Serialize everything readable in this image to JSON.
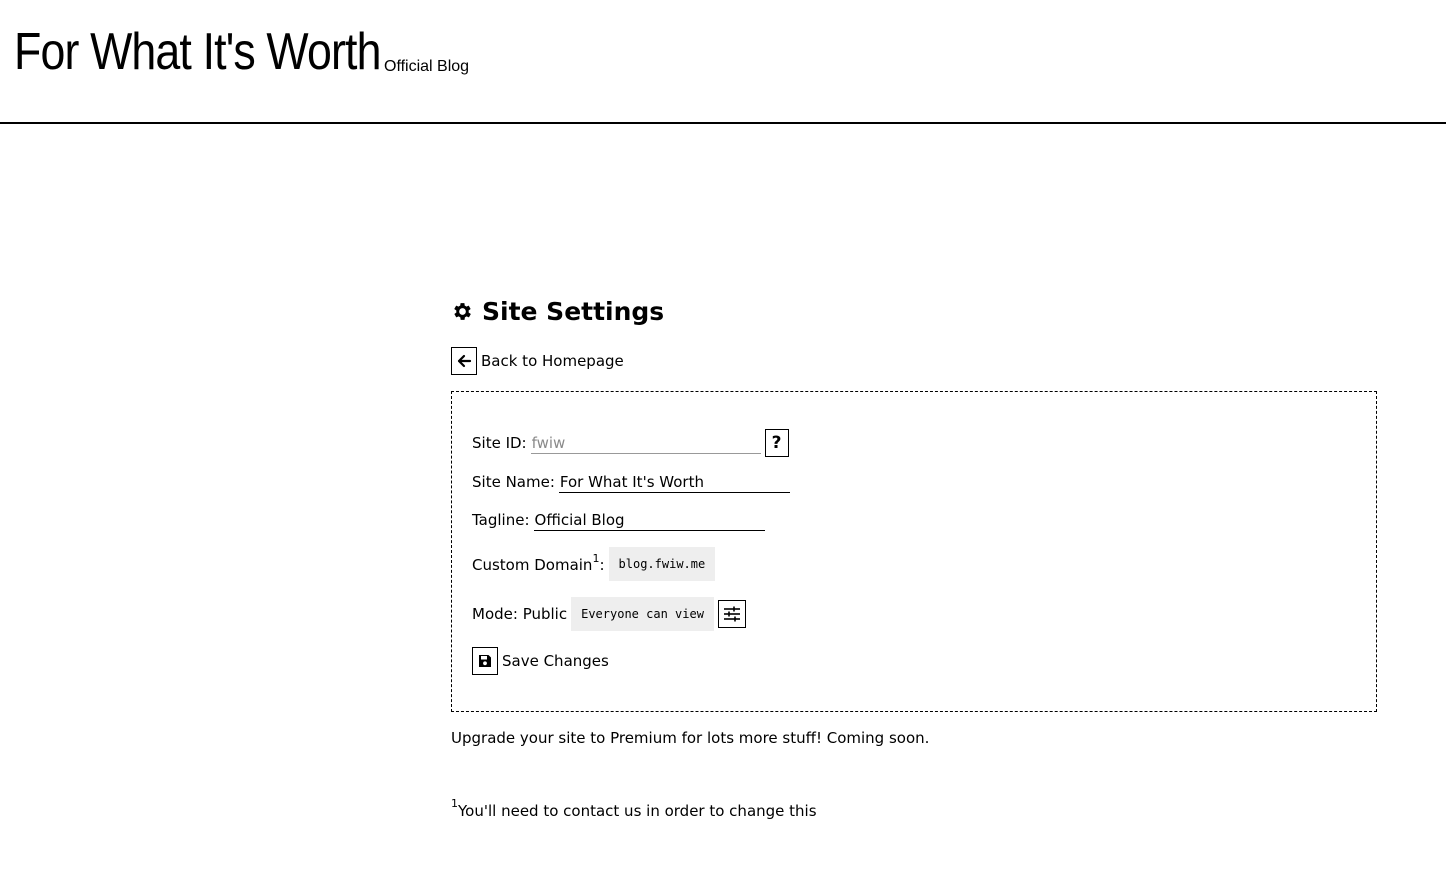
{
  "header": {
    "site_title": "For What It's Worth",
    "tagline": "Official Blog"
  },
  "page": {
    "heading": "Site Settings",
    "heading_icon": "gear-icon",
    "back_label": "Back to Homepage",
    "back_icon": "arrow-left-icon"
  },
  "form": {
    "site_id": {
      "label": "Site ID:",
      "placeholder": "fwiw",
      "value": "",
      "help_label": "?"
    },
    "site_name": {
      "label": "Site Name:",
      "value": "For What It's Worth"
    },
    "tagline": {
      "label": "Tagline:",
      "value": "Official Blog"
    },
    "custom_domain": {
      "label": "Custom Domain",
      "footnote_marker": "1",
      "suffix": ":",
      "value": "blog.fwiw.me"
    },
    "mode": {
      "label": "Mode: Public",
      "description": "Everyone can view",
      "settings_icon": "sliders-icon"
    },
    "save": {
      "label": "Save Changes",
      "icon": "floppy-disk-icon"
    }
  },
  "upgrade_note": "Upgrade your site to Premium for lots more stuff! Coming soon.",
  "footnote": {
    "marker": "1",
    "text": "You'll need to contact us in order to change this"
  }
}
